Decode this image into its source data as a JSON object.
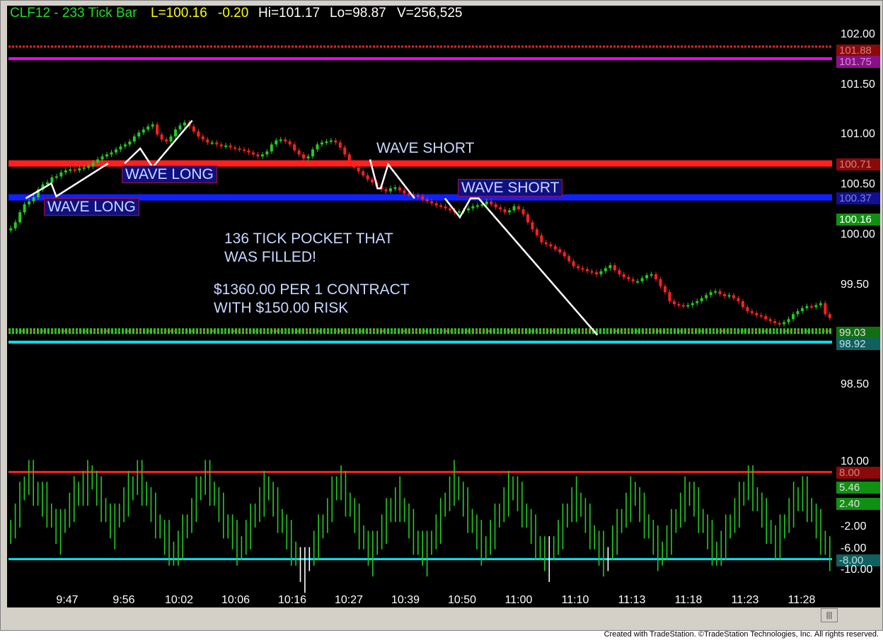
{
  "header": {
    "symbol": "CLF12 - 233 Tick Bar",
    "last": "L=100.16",
    "change": "-0.20",
    "high": "Hi=101.17",
    "low": "Lo=98.87",
    "volume": "V=256,525"
  },
  "annotations": {
    "wave_long_1": "WAVE LONG",
    "wave_long_2": "WAVE LONG",
    "wave_short_1": "WAVE SHORT",
    "wave_short_2": "WAVE SHORT",
    "pocket_line1": "136 TICK POCKET THAT",
    "pocket_line2": "WAS FILLED!",
    "profit_line1": "$1360.00 PER 1 CONTRACT",
    "profit_line2": "WITH $150.00 RISK"
  },
  "footer": "Created with TradeStation. ©TradeStation Technologies, Inc. All rights reserved.",
  "scroll_glyph": "|||",
  "colors": {
    "up_bar": "#22cc22",
    "down_bar": "#ff2020",
    "resistance_red": "#ff2020",
    "support_blue": "#1020ff",
    "magenta": "#ff00ff",
    "cyan": "#00e5ee",
    "wave_line": "#ffffff"
  },
  "chart_data": [
    {
      "type": "line",
      "title": "",
      "x_tick_labels": [
        "9:47",
        "9:56",
        "10:02",
        "10:06",
        "10:16",
        "10:27",
        "10:39",
        "10:50",
        "11:00",
        "11:10",
        "11:13",
        "11:18",
        "11:23",
        "11:28"
      ],
      "ylim": [
        98.3,
        102.1
      ],
      "y_tick_labels": [
        "102.00",
        "101.50",
        "101.00",
        "100.50",
        "100.00",
        "99.50",
        "98.50"
      ],
      "series": [
        {
          "values": [
            100.06,
            100.12,
            100.22,
            100.3,
            100.33,
            100.37,
            100.45,
            100.5,
            100.52,
            100.57,
            100.58,
            100.62,
            100.64,
            100.65,
            100.64,
            100.66,
            100.67,
            100.68,
            100.72,
            100.75,
            100.78,
            100.8,
            100.82,
            100.85,
            100.88,
            100.9,
            100.93,
            100.98,
            101.02,
            101.05,
            101.08,
            101.1,
            101.0,
            100.95,
            100.93,
            100.98,
            101.05,
            101.09,
            101.12,
            101.08,
            101.03,
            100.98,
            100.95,
            100.92,
            100.92,
            100.9,
            100.88,
            100.89,
            100.87,
            100.86,
            100.85,
            100.84,
            100.82,
            100.8,
            100.78,
            100.8,
            100.83,
            100.9,
            100.94,
            100.95,
            100.93,
            100.9,
            100.84,
            100.8,
            100.76,
            100.78,
            100.85,
            100.9,
            100.92,
            100.93,
            100.94,
            100.92,
            100.87,
            100.8,
            100.72,
            100.67,
            100.63,
            100.59,
            100.55,
            100.52,
            100.48,
            100.45,
            100.43,
            100.46,
            100.47,
            100.44,
            100.41,
            100.4,
            100.39,
            100.38,
            100.35,
            100.33,
            100.31,
            100.29,
            100.28,
            100.26,
            100.24,
            100.22,
            100.23,
            100.24,
            100.26,
            100.28,
            100.29,
            100.3,
            100.33,
            100.3,
            100.27,
            100.25,
            100.22,
            100.24,
            100.28,
            100.25,
            100.2,
            100.12,
            100.05,
            99.99,
            99.92,
            99.9,
            99.88,
            99.85,
            99.82,
            99.78,
            99.73,
            99.68,
            99.66,
            99.65,
            99.63,
            99.62,
            99.6,
            99.63,
            99.66,
            99.69,
            99.64,
            99.6,
            99.57,
            99.55,
            99.53,
            99.53,
            99.56,
            99.59,
            99.6,
            99.55,
            99.48,
            99.42,
            99.33,
            99.3,
            99.29,
            99.28,
            99.29,
            99.31,
            99.33,
            99.36,
            99.39,
            99.42,
            99.43,
            99.4,
            99.38,
            99.39,
            99.36,
            99.33,
            99.27,
            99.23,
            99.21,
            99.19,
            99.18,
            99.15,
            99.13,
            99.11,
            99.1,
            99.12,
            99.15,
            99.2,
            99.23,
            99.26,
            99.28,
            99.27,
            99.29,
            99.31,
            99.2,
            99.16
          ]
        }
      ],
      "price_levels": [
        {
          "label": "101.88",
          "value": 101.88,
          "color": "#ff2020"
        },
        {
          "label": "101.75",
          "value": 101.76,
          "color": "#ff00ff"
        },
        {
          "label": "100.71",
          "value": 100.71,
          "color": "#ff2020"
        },
        {
          "label": "100.37",
          "value": 100.37,
          "color": "#1020ff"
        },
        {
          "label": "99.03",
          "value": 99.03,
          "color": "#22cc22"
        },
        {
          "label": "98.92",
          "value": 98.92,
          "color": "#00e5ee"
        }
      ],
      "last_price_tag": {
        "label": "100.16",
        "value": 100.16,
        "color": "#109010"
      },
      "wave_paths": [
        {
          "name": "wave-long-1",
          "points": [
            [
              0.021,
              100.36
            ],
            [
              0.052,
              100.51
            ],
            [
              0.058,
              100.38
            ],
            [
              0.121,
              100.71
            ]
          ]
        },
        {
          "name": "wave-long-2",
          "points": [
            [
              0.141,
              100.71
            ],
            [
              0.16,
              100.86
            ],
            [
              0.175,
              100.67
            ],
            [
              0.223,
              101.14
            ]
          ]
        },
        {
          "name": "wave-short-1",
          "points": [
            [
              0.439,
              100.75
            ],
            [
              0.448,
              100.46
            ],
            [
              0.452,
              100.46
            ],
            [
              0.461,
              100.7
            ],
            [
              0.493,
              100.36
            ]
          ]
        },
        {
          "name": "wave-short-2",
          "points": [
            [
              0.53,
              100.36
            ],
            [
              0.548,
              100.17
            ],
            [
              0.561,
              100.36
            ],
            [
              0.571,
              100.36
            ],
            [
              0.715,
              98.99
            ]
          ]
        }
      ]
    },
    {
      "type": "bar",
      "title": "",
      "ylim": [
        -11.5,
        11.0
      ],
      "y_tick_labels": [
        "10.00",
        "-2.00",
        "-6.00",
        "-10.00"
      ],
      "levels": [
        {
          "label": "8.00",
          "value": 8.0,
          "color": "#ff2020"
        },
        {
          "label": "-8.00",
          "value": -8.0,
          "color": "#00e5ee"
        }
      ],
      "value_tags": [
        {
          "label": "5.46",
          "value": 5.46,
          "color": "#109010"
        },
        {
          "label": "2.40",
          "value": 2.4,
          "color": "#109010"
        }
      ],
      "series": [
        {
          "values": [
            -3,
            -1,
            2,
            5,
            7,
            6,
            4,
            3,
            2,
            0,
            -2,
            -3,
            -1,
            1,
            3,
            4,
            5,
            6,
            7,
            5,
            3,
            1,
            -1,
            -2,
            0,
            2,
            4,
            5,
            7,
            6,
            4,
            2,
            0,
            -2,
            -4,
            -5,
            -7,
            -6,
            -4,
            -2,
            0,
            3,
            5,
            7,
            6,
            4,
            2,
            0,
            -2,
            -3,
            -5,
            -6,
            -4,
            -2,
            0,
            2,
            4,
            5,
            3,
            1,
            -1,
            -3,
            -5,
            -7,
            -9,
            -10,
            -8,
            -6,
            -4,
            -2,
            0,
            3,
            5,
            6,
            4,
            2,
            0,
            -2,
            -4,
            -6,
            -7,
            -5,
            -3,
            -1,
            1,
            2,
            3,
            1,
            -1,
            -3,
            -5,
            -6,
            -7,
            -5,
            -3,
            -1,
            2,
            4,
            6,
            5,
            3,
            1,
            -1,
            -3,
            -5,
            -6,
            -4,
            -2,
            0,
            2,
            4,
            5,
            4,
            2,
            0,
            -2,
            -4,
            -6,
            -7,
            -8,
            -6,
            -4,
            -2,
            0,
            2,
            3,
            2,
            0,
            -2,
            -4,
            -6,
            -7,
            -8,
            -5,
            -3,
            -1,
            1,
            3,
            4,
            2,
            0,
            -2,
            -4,
            -6,
            -7,
            -5,
            -3,
            -1,
            1,
            3,
            4,
            3,
            1,
            -1,
            -3,
            -5,
            -7,
            -6,
            -4,
            -2,
            0,
            2,
            4,
            6,
            5,
            3,
            1,
            -1,
            -3,
            -5,
            -4,
            -2,
            0,
            2,
            3,
            4,
            3,
            1,
            -1,
            -3,
            -5,
            -7
          ]
        }
      ]
    }
  ]
}
